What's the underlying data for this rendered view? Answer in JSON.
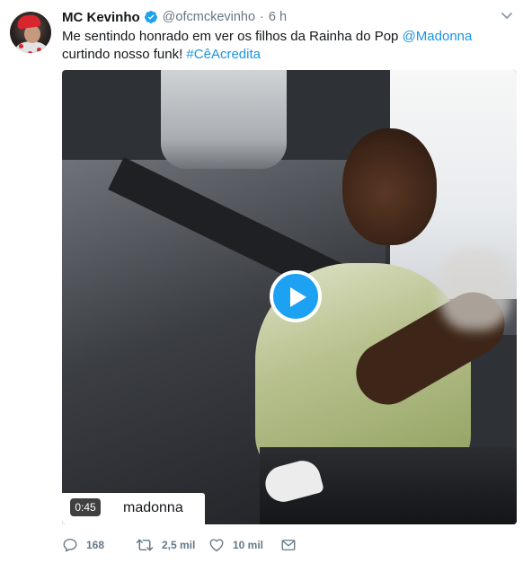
{
  "tweet": {
    "author": {
      "name": "MC Kevinho",
      "handle": "@ofcmckevinho",
      "verified": true
    },
    "separator": "·",
    "time": "6 h",
    "text": {
      "part1": "Me sentindo honrado em ver os filhos da Rainha do Pop ",
      "mention": "@Madonna",
      "part2": " curtindo nosso funk! ",
      "hashtag": "#CêAcredita"
    },
    "media": {
      "type": "video",
      "duration": "0:45",
      "channel": "madonna",
      "play_icon": "play-icon"
    },
    "actions": {
      "reply": {
        "icon": "reply-icon",
        "count": "168"
      },
      "retweet": {
        "icon": "retweet-icon",
        "count": "2,5 mil"
      },
      "like": {
        "icon": "heart-icon",
        "count": "10 mil"
      },
      "dm": {
        "icon": "envelope-icon"
      }
    },
    "colors": {
      "link": "#1b95e0",
      "verified": "#1da1f2",
      "secondary_text": "#657786",
      "play_button": "#1da1f2"
    }
  }
}
